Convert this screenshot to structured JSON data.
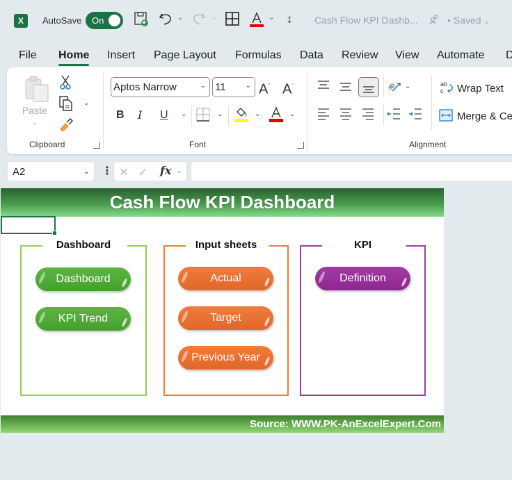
{
  "titlebar": {
    "app_icon": "excel-icon",
    "app_letter": "X",
    "autosave_label": "AutoSave",
    "autosave_state": "On",
    "doc_title": "Cash Flow KPI Dashb...",
    "save_status": "• Saved",
    "icons": [
      "save-icon",
      "undo-icon",
      "redo-icon",
      "borders-icon",
      "font-color-icon",
      "customize-qat-icon"
    ]
  },
  "tabs": [
    "File",
    "Home",
    "Insert",
    "Page Layout",
    "Formulas",
    "Data",
    "Review",
    "View",
    "Automate",
    "D"
  ],
  "active_tab": "Home",
  "ribbon": {
    "clipboard": {
      "label": "Clipboard",
      "paste_label": "Paste"
    },
    "font": {
      "label": "Font",
      "font_name": "Aptos Narrow",
      "font_size": "11",
      "bold": "B",
      "italic": "I",
      "underline": "U",
      "font_color": "#e00000",
      "highlight_color": "#ffff00"
    },
    "alignment": {
      "label": "Alignment",
      "wrap_text": "Wrap Text",
      "merge_center": "Merge & Ce"
    }
  },
  "formula_bar": {
    "name_box": "A2",
    "fx": "fx",
    "formula": ""
  },
  "sheet": {
    "banner_title": "Cash Flow KPI Dashboard",
    "footer_source": "Source: WWW.PK-AnExcelExpert.Com",
    "groups": [
      {
        "title": "Dashboard",
        "color": "#92d050",
        "buttons": [
          "Dashboard",
          "KPI Trend"
        ]
      },
      {
        "title": "Input sheets",
        "color": "#ed7d31",
        "buttons": [
          "Actual",
          "Target",
          "Previous Year"
        ]
      },
      {
        "title": "KPI",
        "color": "#a03ca0",
        "buttons": [
          "Definition"
        ]
      }
    ]
  }
}
